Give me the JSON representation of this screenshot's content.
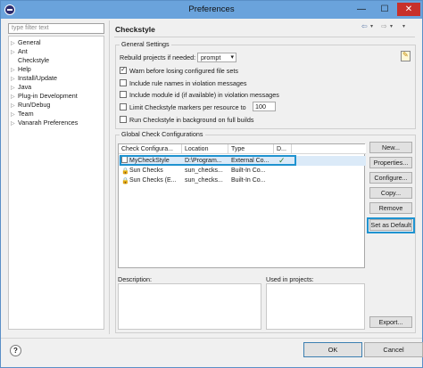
{
  "window": {
    "title": "Preferences",
    "minimize": "—",
    "maximize": "☐",
    "close": "✕"
  },
  "sidebar": {
    "filter_placeholder": "type filter text",
    "items": [
      {
        "label": "General",
        "expandable": true
      },
      {
        "label": "Ant",
        "expandable": true
      },
      {
        "label": "Checkstyle",
        "expandable": false
      },
      {
        "label": "Help",
        "expandable": true
      },
      {
        "label": "Install/Update",
        "expandable": true
      },
      {
        "label": "Java",
        "expandable": true
      },
      {
        "label": "Plug-in Development",
        "expandable": true
      },
      {
        "label": "Run/Debug",
        "expandable": true
      },
      {
        "label": "Team",
        "expandable": true
      },
      {
        "label": "Vanarah Preferences",
        "expandable": true
      }
    ]
  },
  "page": {
    "title": "Checkstyle",
    "nav": {
      "back": "⇦",
      "back_menu": "▾",
      "forward": "⇨",
      "forward_menu": "▾",
      "menu": "▾"
    },
    "general": {
      "label": "General Settings",
      "rebuild_label": "Rebuild projects if needed:",
      "rebuild_value": "prompt",
      "options": [
        {
          "label": "Warn before losing configured file sets",
          "checked": true
        },
        {
          "label": "Include rule names in violation messages",
          "checked": false
        },
        {
          "label": "Include module id (if available) in violation messages",
          "checked": false
        },
        {
          "label": "Limit Checkstyle markers per resource to",
          "checked": false
        },
        {
          "label": "Run Checkstyle in background on full builds",
          "checked": false
        }
      ],
      "markers_limit": "100"
    },
    "global": {
      "label": "Global Check Configurations",
      "columns": [
        "Check Configura...",
        "Location",
        "Type",
        "D..."
      ],
      "rows": [
        {
          "name": "MyCheckStyle",
          "location": "D:\\Program...",
          "type": "External Co...",
          "default": "✓",
          "icon": "file-icon"
        },
        {
          "name": "Sun Checks",
          "location": "sun_checks...",
          "type": "Built-In Co...",
          "default": "",
          "icon": "lock-icon"
        },
        {
          "name": "Sun Checks (E...",
          "location": "sun_checks...",
          "type": "Built-In Co...",
          "default": "",
          "icon": "lock-icon"
        }
      ],
      "buttons": {
        "new": "New...",
        "properties": "Properties...",
        "configure": "Configure...",
        "copy": "Copy...",
        "remove": "Remove",
        "set_default": "Set as Default",
        "export": "Export..."
      },
      "description_label": "Description:",
      "used_in_label": "Used in projects:"
    }
  },
  "footer": {
    "help": "?",
    "ok": "OK",
    "cancel": "Cancel"
  },
  "colors": {
    "highlight": "#1f93d0",
    "titlebar": "#6aa3dc",
    "close": "#c7312b"
  }
}
